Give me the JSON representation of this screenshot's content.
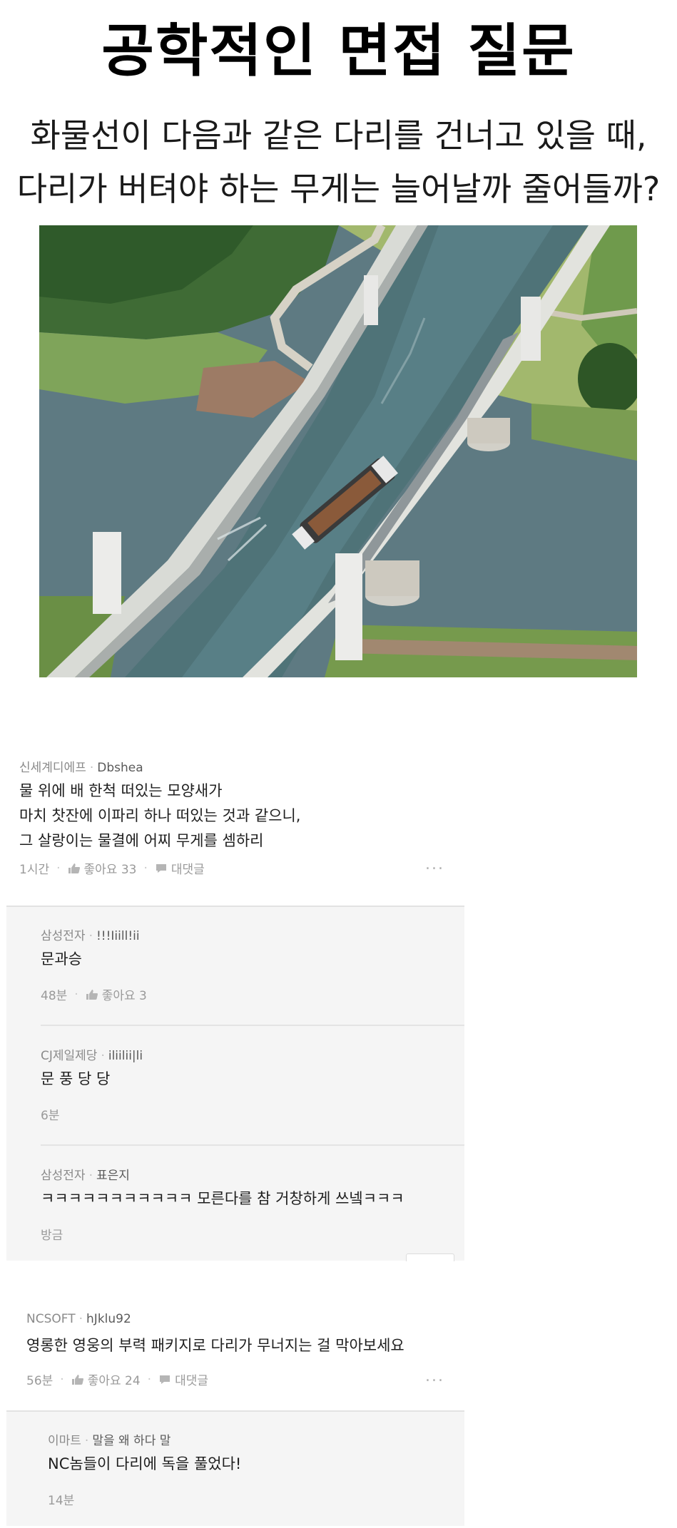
{
  "header": {
    "title": "공학적인 면접 질문",
    "question_line1": "화물선이 다음과 같은 다리를 건너고 있을 때,",
    "question_line2": "다리가 버텨야 하는 무게는 늘어날까 줄어들까?"
  },
  "photo": {
    "subject": "cargo ship crossing water bridge aqueduct"
  },
  "icons": {
    "like": "thumbs-up-icon",
    "reply": "speech-bubble-icon",
    "more": "more-dots-icon"
  },
  "comments": [
    {
      "company": "신세계디에프",
      "nickname": "Dbshea",
      "lines": [
        "물 위에 배 한척 떠있는 모양새가",
        "마치 찻잔에 이파리 하나 떠있는 것과 같으니,",
        "그 살랑이는 물결에 어찌 무게를 셈하리"
      ],
      "time": "1시간",
      "likes": "좋아요 33",
      "reply_label": "대댓글",
      "more": "...",
      "replies": [
        {
          "company": "삼성전자",
          "nickname": "!!!Iiill!ii",
          "text": "문과승",
          "time": "48분",
          "likes": "좋아요 3"
        },
        {
          "company": "CJ제일제당",
          "nickname": "iliilii|li",
          "text": "문 풍 당 당",
          "time": "6분"
        },
        {
          "company": "삼성전자",
          "nickname": "표은지",
          "text": "ㅋㅋㅋㅋㅋㅋㅋㅋㅋㅋㅋ 모른다를 참 거창하게 쓰넼ㅋㅋㅋ",
          "time": "방금"
        }
      ]
    },
    {
      "company": "NCSOFT",
      "nickname": "hJklu92",
      "lines": [
        "영롱한 영웅의 부력 패키지로 다리가 무너지는 걸 막아보세요"
      ],
      "time": "56분",
      "likes": "좋아요 24",
      "reply_label": "대댓글",
      "more": "...",
      "replies": [
        {
          "company": "이마트",
          "nickname": "말을 왜 하다 말",
          "text": "NC놈들이 다리에 독을 풀었다!",
          "time": "14분"
        }
      ]
    }
  ]
}
